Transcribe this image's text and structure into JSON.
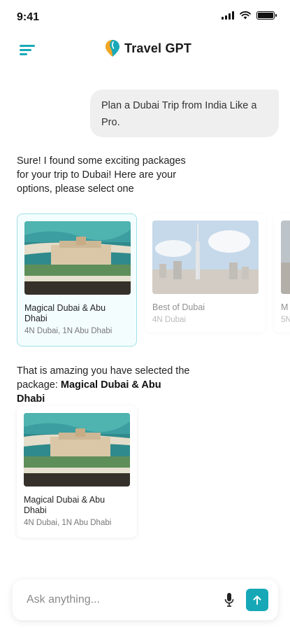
{
  "status_bar": {
    "time": "9:41"
  },
  "header": {
    "app_title": "Travel GPT",
    "menu_icon": "hamburger-menu-icon",
    "logo_icon": "location-pin-logo-icon"
  },
  "colors": {
    "accent": "#16a8b6",
    "bubble_bg": "#efefef",
    "selected_border": "#9fe1e7"
  },
  "conversation": {
    "user_message": "Plan a Dubai Trip from India Like a Pro.",
    "bot_intro": "Sure! I found some exciting packages for your trip to Dubai! Here are your options, please select one",
    "packages": [
      {
        "title": "Magical Dubai & Abu Dhabi",
        "subtitle": "4N Dubai, 1N Abu Dhabi",
        "selected": true
      },
      {
        "title": "Best of Dubai",
        "subtitle": "4N Dubai",
        "selected": false
      },
      {
        "title": "M",
        "subtitle": "5N",
        "selected": false
      }
    ],
    "selection_prefix": "That is amazing you have selected the package: ",
    "selection_name": "Magical Dubai & Abu Dhabi",
    "selected_package": {
      "title": "Magical Dubai & Abu Dhabi",
      "subtitle": "4N Dubai, 1N Abu Dhabi"
    }
  },
  "composer": {
    "placeholder": "Ask anything...",
    "mic_icon": "microphone-icon",
    "send_icon": "send-arrow-icon"
  }
}
